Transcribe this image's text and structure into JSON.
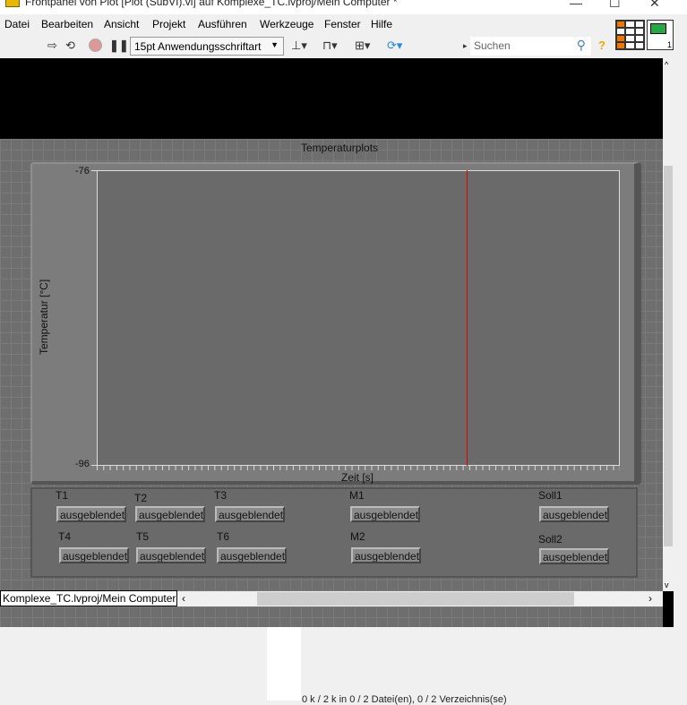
{
  "window": {
    "title": "Frontpanel von Plot  [Plot (SubVI).vi] auf Komplexe_TC.lvproj/Mein Computer *",
    "minimize": "—",
    "maximize": "☐",
    "close": "✕"
  },
  "menu": [
    "Datei",
    "Bearbeiten",
    "Ansicht",
    "Projekt",
    "Ausführen",
    "Werkzeuge",
    "Fenster",
    "Hilfe"
  ],
  "toolbar": {
    "font": "15pt Anwendungsschriftart",
    "search_placeholder": "Suchen",
    "icon_number": "1"
  },
  "graph": {
    "title": "Temperaturplots",
    "ylabel": "Temperatur [°C]",
    "xlabel": "Zeit [s]",
    "ymax": "-76",
    "ymin": "-96",
    "cursor_color": "#e00000"
  },
  "legend": {
    "items": [
      {
        "label": "T1",
        "value": "ausgeblendet"
      },
      {
        "label": "T2",
        "value": "ausgeblendet"
      },
      {
        "label": "T3",
        "value": "ausgeblendet"
      },
      {
        "label": "M1",
        "value": "ausgeblendet"
      },
      {
        "label": "Soll1",
        "value": "ausgeblendet"
      },
      {
        "label": "T4",
        "value": "ausgeblendet"
      },
      {
        "label": "T5",
        "value": "ausgeblendet"
      },
      {
        "label": "T6",
        "value": "ausgeblendet"
      },
      {
        "label": "M2",
        "value": "ausgeblendet"
      },
      {
        "label": "Soll2",
        "value": "ausgeblendet"
      }
    ]
  },
  "footer": {
    "path": "Komplexe_TC.lvproj/Mein Computer",
    "status": "0 k / 2 k in 0 / 2 Datei(en), 0 / 2 Verzeichnis(se)"
  }
}
